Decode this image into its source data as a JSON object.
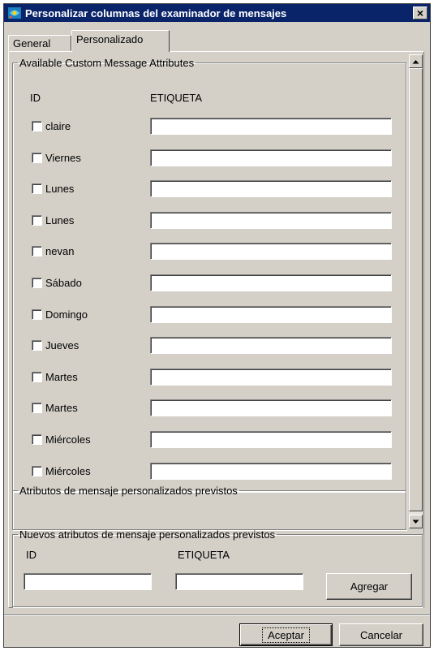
{
  "window": {
    "title": "Personalizar columnas del examinador de mensajes",
    "close_label": "×"
  },
  "tabs": [
    {
      "label": "General",
      "active": false
    },
    {
      "label": "Personalizado",
      "active": true
    }
  ],
  "available_group": {
    "legend": "Available Custom Message Attributes",
    "col_id": "ID",
    "col_label": "ETIQUETA",
    "rows": [
      {
        "id": "claire",
        "checked": false,
        "value": ""
      },
      {
        "id": "Viernes",
        "checked": false,
        "value": ""
      },
      {
        "id": "Lunes",
        "checked": false,
        "value": ""
      },
      {
        "id": "Lunes",
        "checked": false,
        "value": ""
      },
      {
        "id": "nevan",
        "checked": false,
        "value": ""
      },
      {
        "id": "Sábado",
        "checked": false,
        "value": ""
      },
      {
        "id": "Domingo",
        "checked": false,
        "value": ""
      },
      {
        "id": "Jueves",
        "checked": false,
        "value": ""
      },
      {
        "id": "Martes",
        "checked": false,
        "value": ""
      },
      {
        "id": "Martes",
        "checked": false,
        "value": ""
      },
      {
        "id": "Miércoles",
        "checked": false,
        "value": ""
      },
      {
        "id": "Miércoles",
        "checked": false,
        "value": ""
      }
    ]
  },
  "predefined_group": {
    "legend": "Atributos de mensaje personalizados previstos"
  },
  "new_group": {
    "legend": "Nuevos atributos de mensaje personalizados previstos",
    "col_id": "ID",
    "col_label": "ETIQUETA",
    "id_value": "",
    "label_value": "",
    "add_button": "Agregar"
  },
  "footer": {
    "ok_button": "Aceptar",
    "cancel_button": "Cancelar"
  }
}
